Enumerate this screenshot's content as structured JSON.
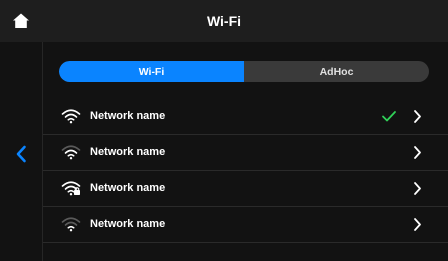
{
  "header": {
    "title": "Wi-Fi"
  },
  "tabs": [
    {
      "label": "Wi-Fi",
      "active": true
    },
    {
      "label": "AdHoc",
      "active": false
    }
  ],
  "networks": [
    {
      "name": "Network name",
      "signal": "wifi-strong-icon",
      "secured": false,
      "connected": true
    },
    {
      "name": "Network name",
      "signal": "wifi-medium-icon",
      "secured": false,
      "connected": false
    },
    {
      "name": "Network name",
      "signal": "wifi-locked-icon",
      "secured": true,
      "connected": false
    },
    {
      "name": "Network name",
      "signal": "wifi-weak-icon",
      "secured": false,
      "connected": false
    }
  ],
  "colors": {
    "accent": "#0a84ff",
    "check": "#30d158",
    "topbar": "#1e1e1e",
    "background": "#121212"
  }
}
